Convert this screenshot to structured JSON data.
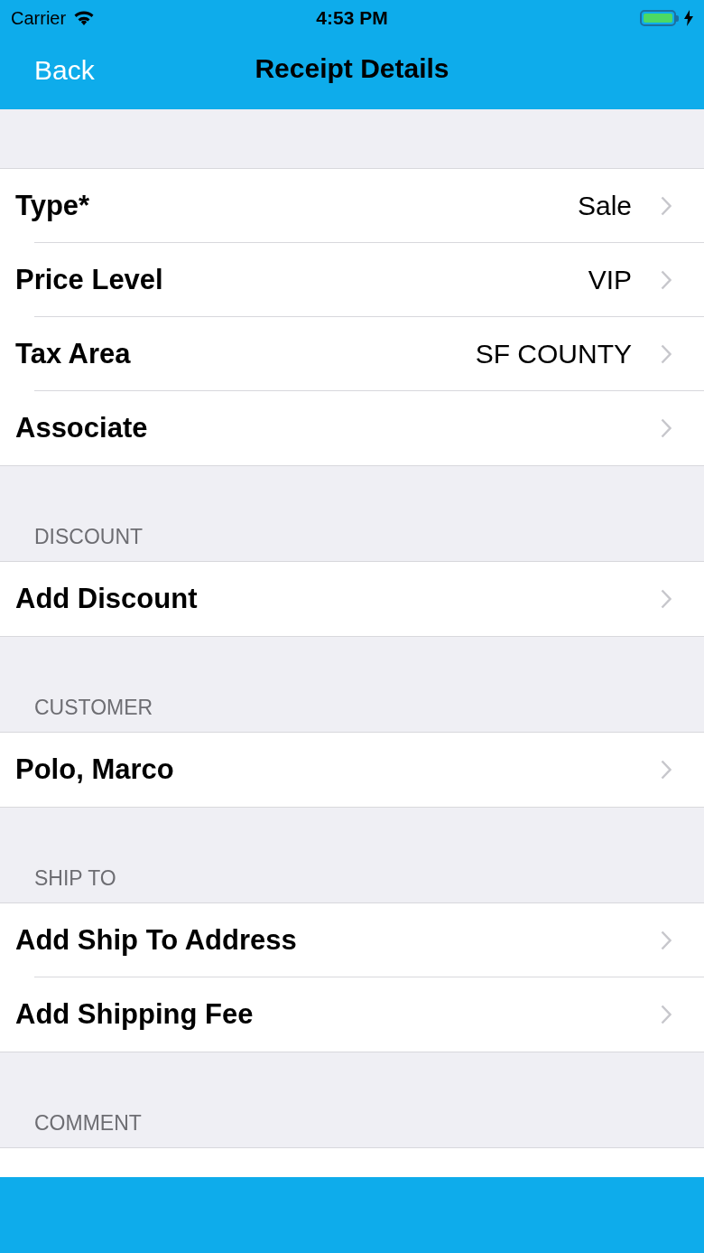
{
  "status_bar": {
    "carrier": "Carrier",
    "time": "4:53 PM",
    "battery": {
      "level": 1,
      "charging": true
    }
  },
  "nav": {
    "back": "Back",
    "title": "Receipt Details"
  },
  "sections": [
    {
      "rows": [
        {
          "label": "Type*",
          "value": "Sale"
        },
        {
          "label": "Price Level",
          "value": "VIP"
        },
        {
          "label": "Tax Area",
          "value": "SF COUNTY"
        },
        {
          "label": "Associate"
        }
      ]
    },
    {
      "header": "DISCOUNT",
      "rows": [
        {
          "label": "Add Discount"
        }
      ]
    },
    {
      "header": "CUSTOMER",
      "rows": [
        {
          "label": "Polo, Marco"
        }
      ]
    },
    {
      "header": "SHIP TO",
      "rows": [
        {
          "label": "Add Ship To Address"
        },
        {
          "label": "Add Shipping Fee"
        }
      ]
    },
    {
      "header": "COMMENT"
    }
  ]
}
